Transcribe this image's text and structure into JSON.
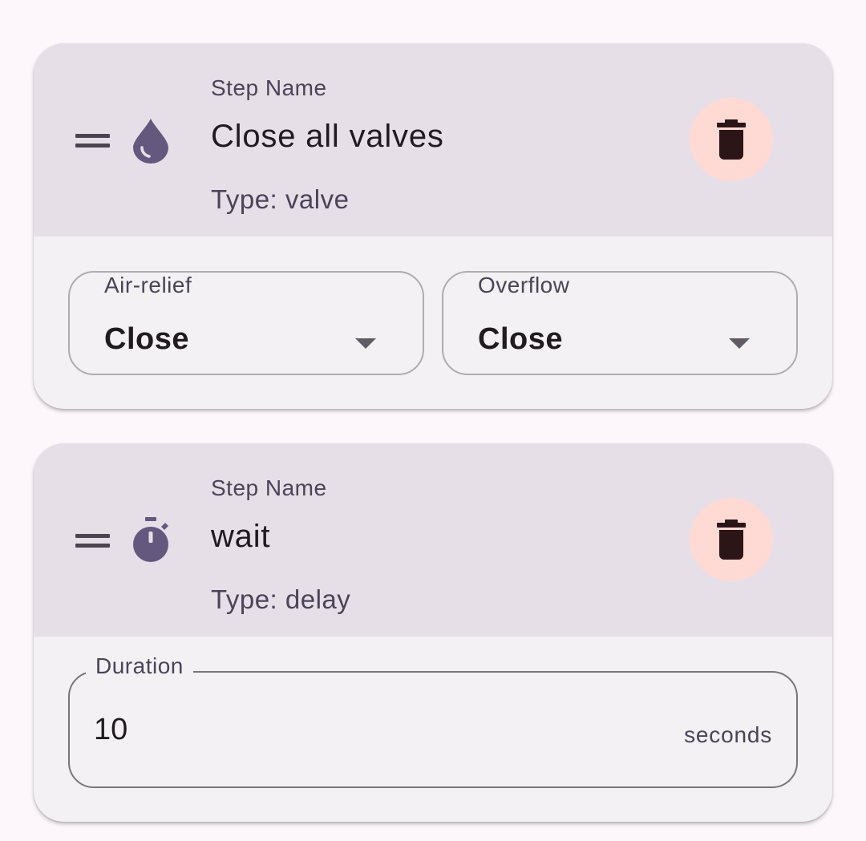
{
  "steps": [
    {
      "icon": "water-drop-icon",
      "step_name_label": "Step Name",
      "step_name": "Close all valves",
      "type_text": "Type: valve",
      "delete_icon": "trash-icon",
      "dropdowns": [
        {
          "label": "Air-relief",
          "value": "Close"
        },
        {
          "label": "Overflow",
          "value": "Close"
        }
      ]
    },
    {
      "icon": "stopwatch-icon",
      "step_name_label": "Step Name",
      "step_name": "wait",
      "type_text": "Type: delay",
      "delete_icon": "trash-icon",
      "duration": {
        "label": "Duration",
        "value": "10",
        "suffix": "seconds"
      }
    }
  ],
  "colors": {
    "background": "#fdf7fb",
    "card_header": "#e7dfe8",
    "card_body": "#f3f1f3",
    "icon_accent": "#65587f",
    "delete_bg": "#ffd9d4",
    "delete_icon": "#2b1517"
  }
}
